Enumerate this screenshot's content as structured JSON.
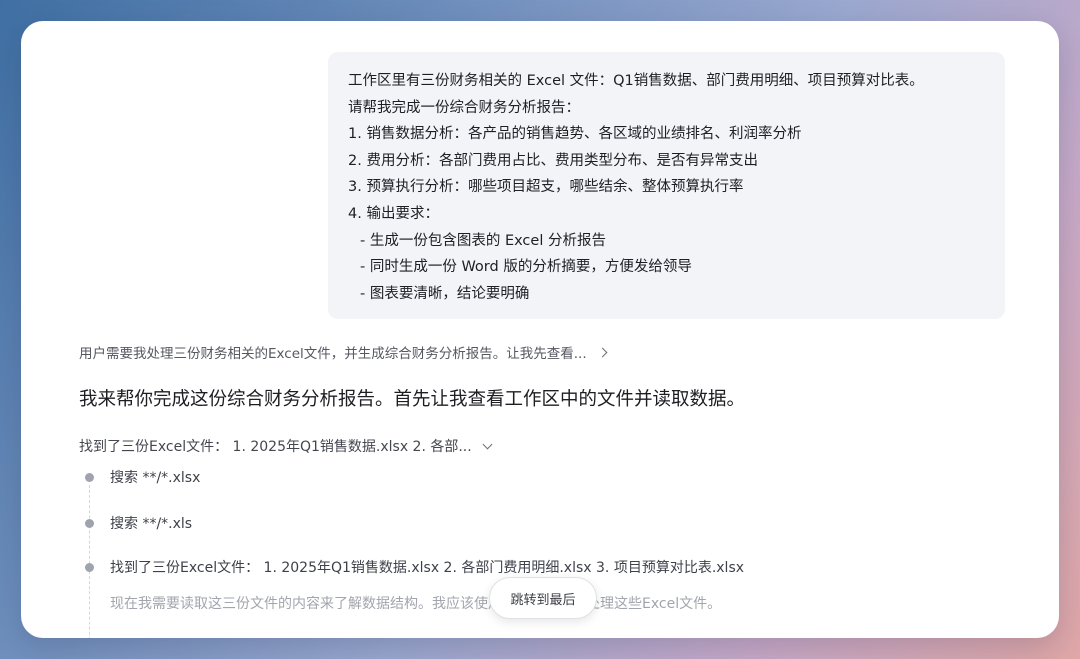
{
  "user_message": {
    "lines": [
      "工作区里有三份财务相关的 Excel 文件：Q1销售数据、部门费用明细、项目预算对比表。",
      "请帮我完成一份综合财务分析报告：",
      "1. 销售数据分析：各产品的销售趋势、各区域的业绩排名、利润率分析",
      "2. 费用分析：各部门费用占比、费用类型分布、是否有异常支出",
      "3. 预算执行分析：哪些项目超支，哪些结余、整体预算执行率",
      "4. 输出要求：",
      "- 生成一份包含图表的 Excel 分析报告",
      "- 同时生成一份 Word 版的分析摘要，方便发给领导",
      "- 图表要清晰，结论要明确"
    ]
  },
  "thinking": {
    "summary": "用户需要我处理三份财务相关的Excel文件，并生成综合财务分析报告。让我先查看...",
    "icon": "chevron-right-icon"
  },
  "assistant_reply": "我来帮你完成这份综合财务分析报告。首先让我查看工作区中的文件并读取数据。",
  "tool_group": {
    "summary": "找到了三份Excel文件： 1. 2025年Q1销售数据.xlsx 2. 各部...",
    "icon": "chevron-down-icon",
    "steps": [
      {
        "label": "搜索 **/*.xlsx"
      },
      {
        "label": "搜索 **/*.xls"
      },
      {
        "label": "找到了三份Excel文件： 1. 2025年Q1销售数据.xlsx 2. 各部门费用明细.xlsx 3. 项目预算对比表.xlsx"
      }
    ],
    "status_text": "现在我需要读取这三份文件的内容来了解数据结构。我应该使用合适的工具来处理这些Excel文件。"
  },
  "jump_to_end_label": "跳转到最后",
  "colors": {
    "user_bubble_bg": "#f3f4f8",
    "timeline_dot": "#9fa3ad",
    "muted_text": "#a2a5ad"
  }
}
